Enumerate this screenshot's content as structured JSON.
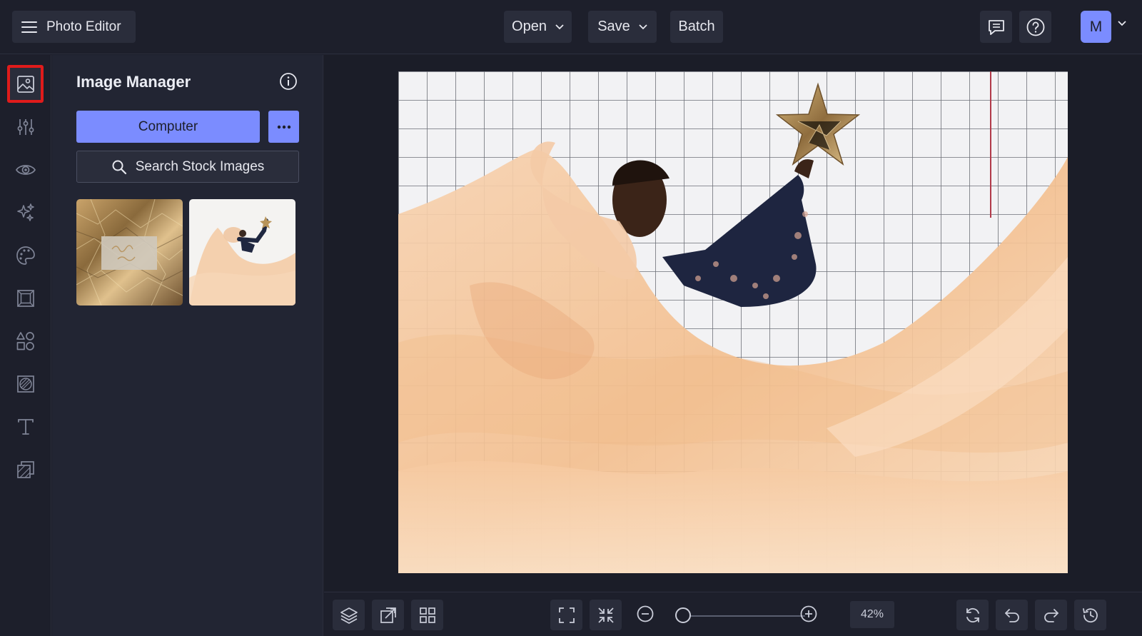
{
  "app": {
    "title": "Photo Editor",
    "menu_icon": "hamburger-icon"
  },
  "toolbar": {
    "open_label": "Open",
    "save_label": "Save",
    "batch_label": "Batch",
    "avatar_initial": "M"
  },
  "rail": {
    "items": [
      {
        "name": "image-manager",
        "icon": "image-icon",
        "active": true
      },
      {
        "name": "adjustments",
        "icon": "sliders-icon"
      },
      {
        "name": "effects",
        "icon": "eye-icon"
      },
      {
        "name": "touch-up",
        "icon": "sparkle-icon"
      },
      {
        "name": "artsy",
        "icon": "palette-icon"
      },
      {
        "name": "frames",
        "icon": "frame-icon"
      },
      {
        "name": "graphics",
        "icon": "shapes-icon"
      },
      {
        "name": "overlays",
        "icon": "overlay-icon"
      },
      {
        "name": "text",
        "icon": "text-icon"
      },
      {
        "name": "textures",
        "icon": "texture-icon"
      }
    ]
  },
  "panel": {
    "title": "Image Manager",
    "computer_label": "Computer",
    "search_label": "Search Stock Images",
    "thumbnails": [
      {
        "name": "gold-foil-thumbnail"
      },
      {
        "name": "tulle-dress-thumbnail"
      }
    ]
  },
  "bottombar": {
    "zoom_value": "42",
    "zoom_unit": "%",
    "zoom_fraction": 0.04
  },
  "colors": {
    "accent": "#7b8cff",
    "background": "#1d1f2b",
    "panel": "#222533",
    "active_outline": "#e01b1b"
  }
}
